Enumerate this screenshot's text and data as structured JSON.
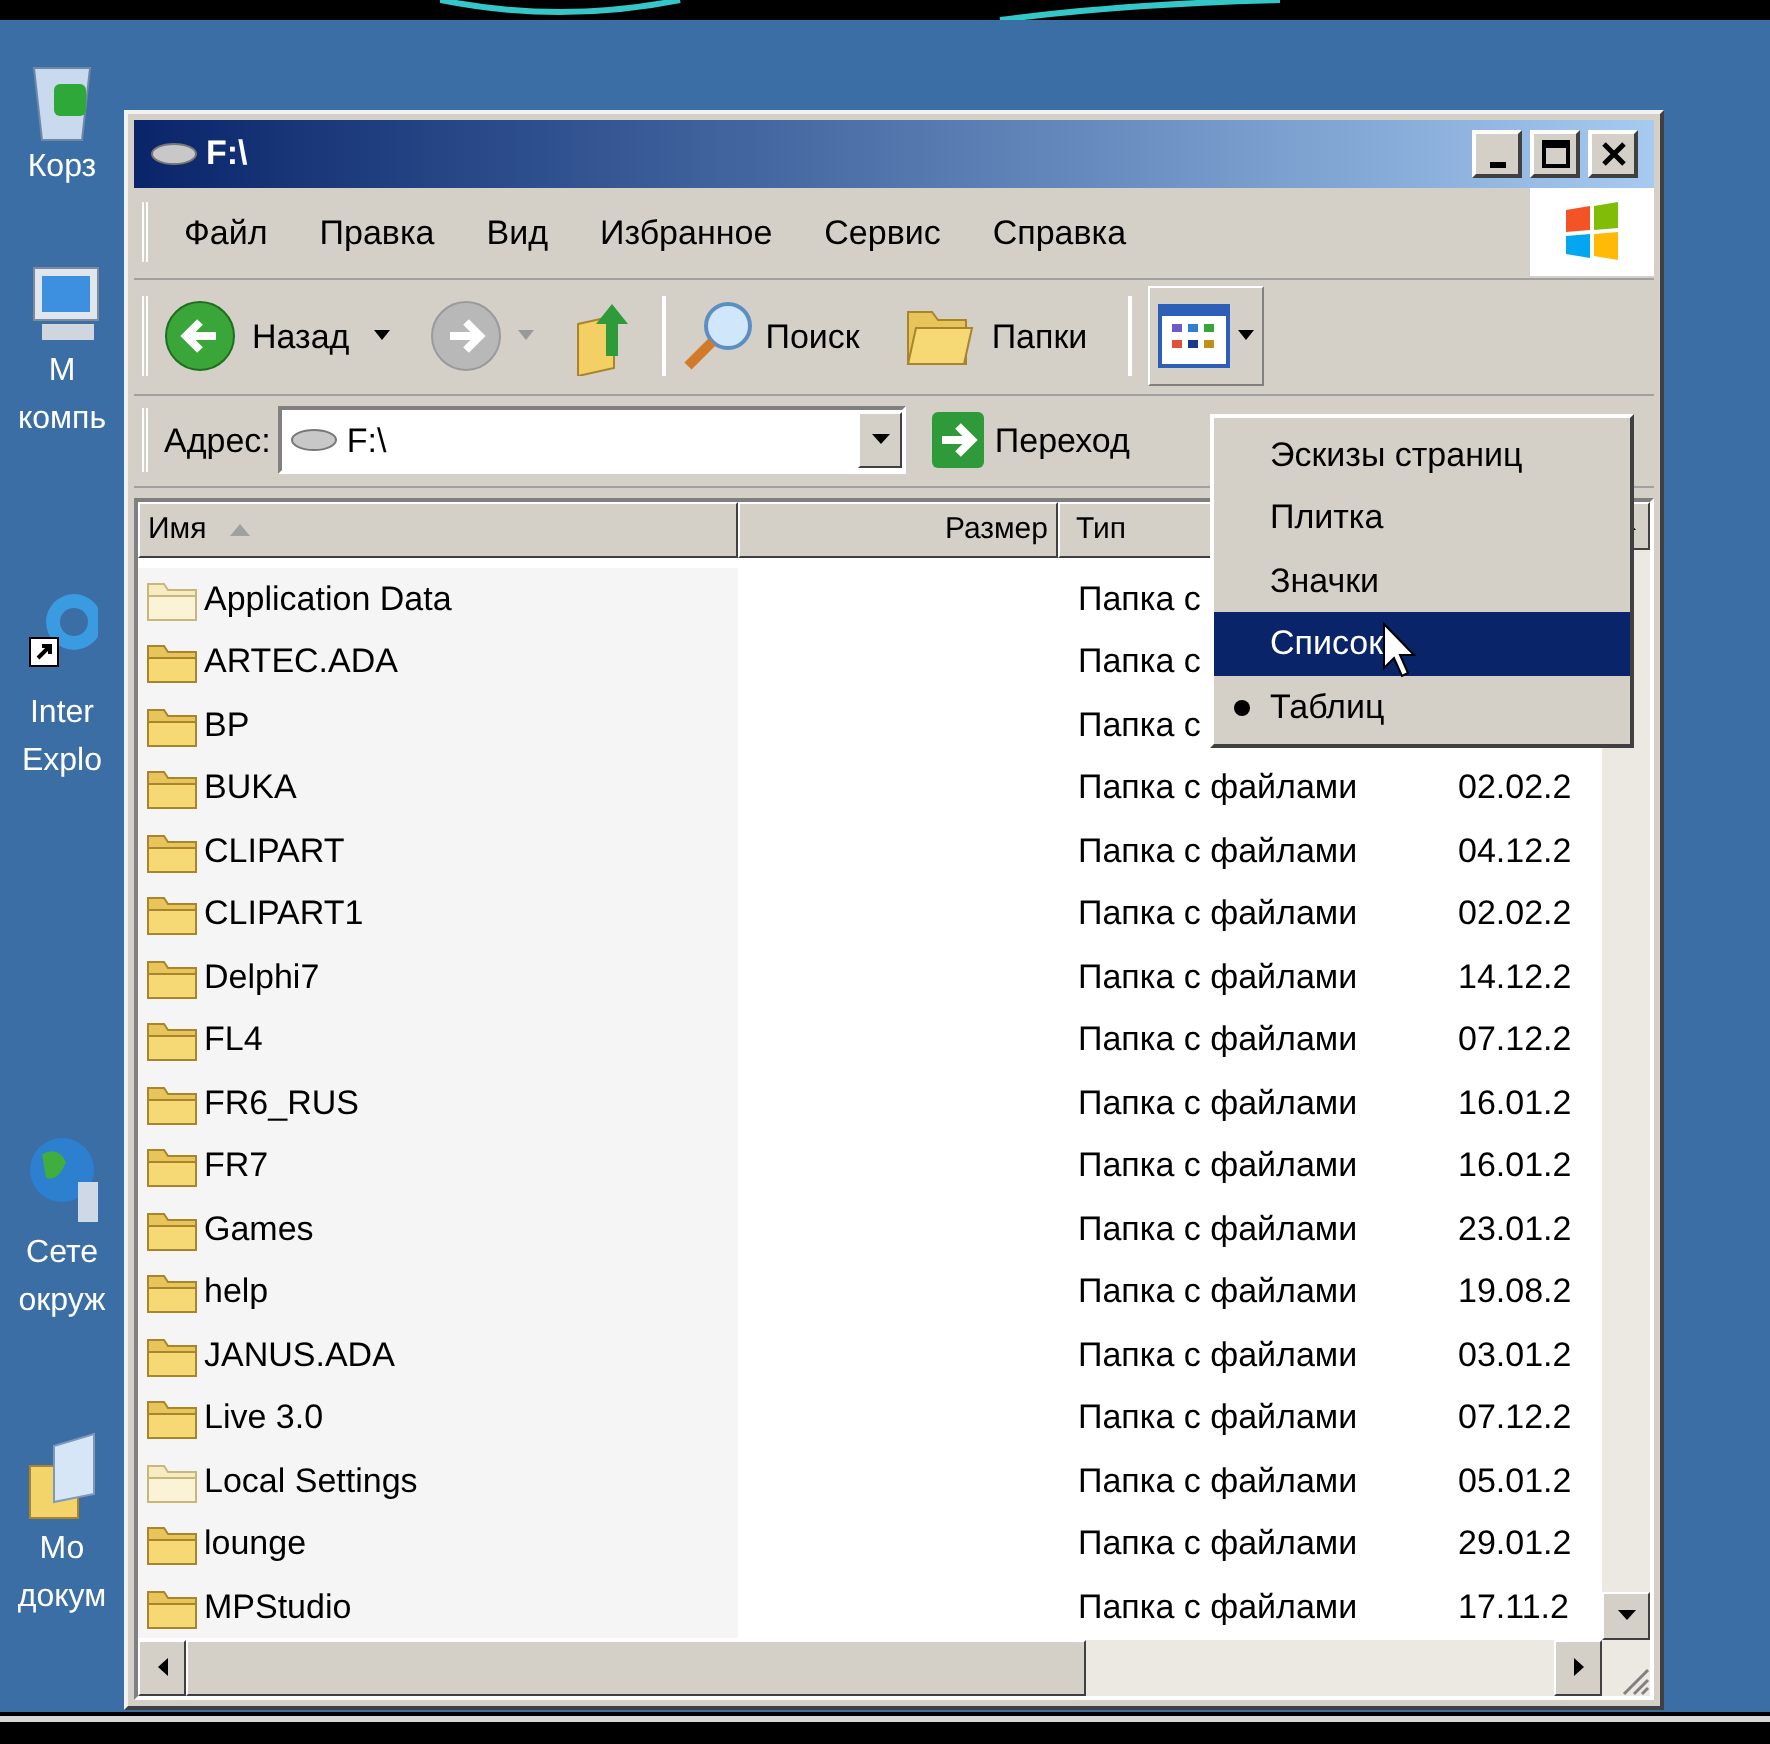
{
  "desktop_icons": [
    {
      "kind": "recycle",
      "lines": [
        "Корз"
      ]
    },
    {
      "kind": "computer",
      "lines": [
        "М",
        "компь"
      ]
    },
    {
      "kind": "browser",
      "lines": [
        "Inter",
        "Explo"
      ]
    },
    {
      "kind": "network",
      "lines": [
        "Сете",
        "окруж"
      ]
    },
    {
      "kind": "documents",
      "lines": [
        "Мо",
        "докум"
      ]
    }
  ],
  "window": {
    "title": "F:\\"
  },
  "menu_bar": [
    "Файл",
    "Правка",
    "Вид",
    "Избранное",
    "Сервис",
    "Справка"
  ],
  "toolbar": {
    "back": "Назад",
    "search": "Поиск",
    "folders": "Папки"
  },
  "address_bar": {
    "label": "Адрес:",
    "value": "F:\\",
    "go": "Переход"
  },
  "columns": [
    "Имя",
    "Размер",
    "Тип"
  ],
  "rows": [
    {
      "name": "Application Data",
      "type": "Папка с",
      "hidden": true
    },
    {
      "name": "ARTEC.ADA",
      "type": "Папка с",
      "hidden": false
    },
    {
      "name": "BP",
      "type": "Папка с",
      "hidden": false
    },
    {
      "name": "BUKA",
      "type": "Папка с файлами",
      "date": "02.02.2",
      "hidden": false
    },
    {
      "name": "CLIPART",
      "type": "Папка с файлами",
      "date": "04.12.2",
      "hidden": false
    },
    {
      "name": "CLIPART1",
      "type": "Папка с файлами",
      "date": "02.02.2",
      "hidden": false
    },
    {
      "name": "Delphi7",
      "type": "Папка с файлами",
      "date": "14.12.2",
      "hidden": false
    },
    {
      "name": "FL4",
      "type": "Папка с файлами",
      "date": "07.12.2",
      "hidden": false
    },
    {
      "name": "FR6_RUS",
      "type": "Папка с файлами",
      "date": "16.01.2",
      "hidden": false
    },
    {
      "name": "FR7",
      "type": "Папка с файлами",
      "date": "16.01.2",
      "hidden": false
    },
    {
      "name": "Games",
      "type": "Папка с файлами",
      "date": "23.01.2",
      "hidden": false
    },
    {
      "name": "help",
      "type": "Папка с файлами",
      "date": "19.08.2",
      "hidden": false
    },
    {
      "name": "JANUS.ADA",
      "type": "Папка с файлами",
      "date": "03.01.2",
      "hidden": false
    },
    {
      "name": "Live 3.0",
      "type": "Папка с файлами",
      "date": "07.12.2",
      "hidden": false
    },
    {
      "name": "Local Settings",
      "type": "Папка с файлами",
      "date": "05.01.2",
      "hidden": true
    },
    {
      "name": "lounge",
      "type": "Папка с файлами",
      "date": "29.01.2",
      "hidden": false
    },
    {
      "name": "MPStudio",
      "type": "Папка с файлами",
      "date": "17.11.2",
      "hidden": false
    }
  ],
  "views_menu": [
    {
      "label": "Эскизы страниц",
      "selected": false,
      "checked": false
    },
    {
      "label": "Плитка",
      "selected": false,
      "checked": false
    },
    {
      "label": "Значки",
      "selected": false,
      "checked": false
    },
    {
      "label": "Список",
      "selected": true,
      "checked": false
    },
    {
      "label": "Таблиц",
      "selected": false,
      "checked": true
    }
  ]
}
